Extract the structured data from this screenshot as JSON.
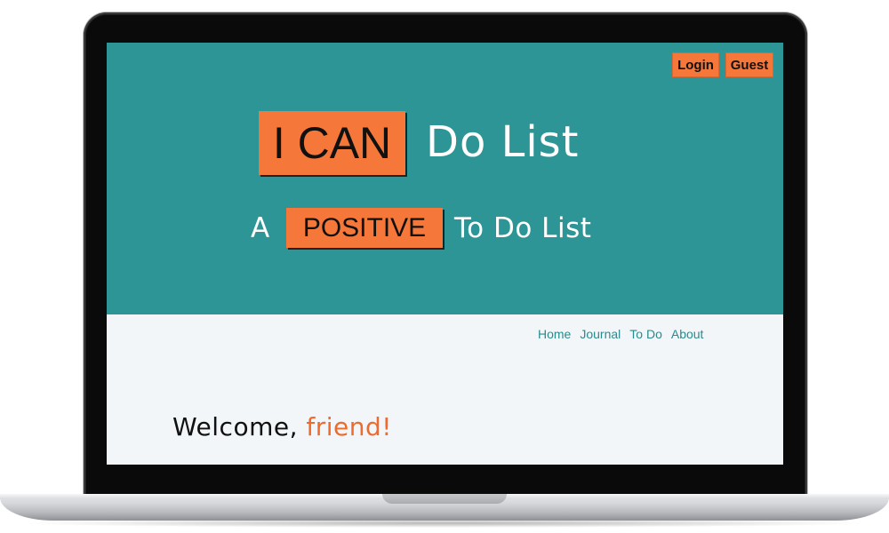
{
  "auth": {
    "login_label": "Login",
    "guest_label": "Guest"
  },
  "hero": {
    "title_highlight": "I CAN",
    "title_rest": "Do List",
    "subtitle_prefix": "A",
    "subtitle_highlight": "POSITIVE",
    "subtitle_rest": "To Do List"
  },
  "nav": {
    "items": [
      "Home",
      "Journal",
      "To Do",
      "About"
    ]
  },
  "welcome": {
    "greeting": "Welcome,",
    "name": "friend!"
  },
  "colors": {
    "hero_bg": "#2e9596",
    "accent_orange": "#f5783a",
    "page_bg": "#f2f6f9",
    "nav_link": "#2a8a8c"
  }
}
